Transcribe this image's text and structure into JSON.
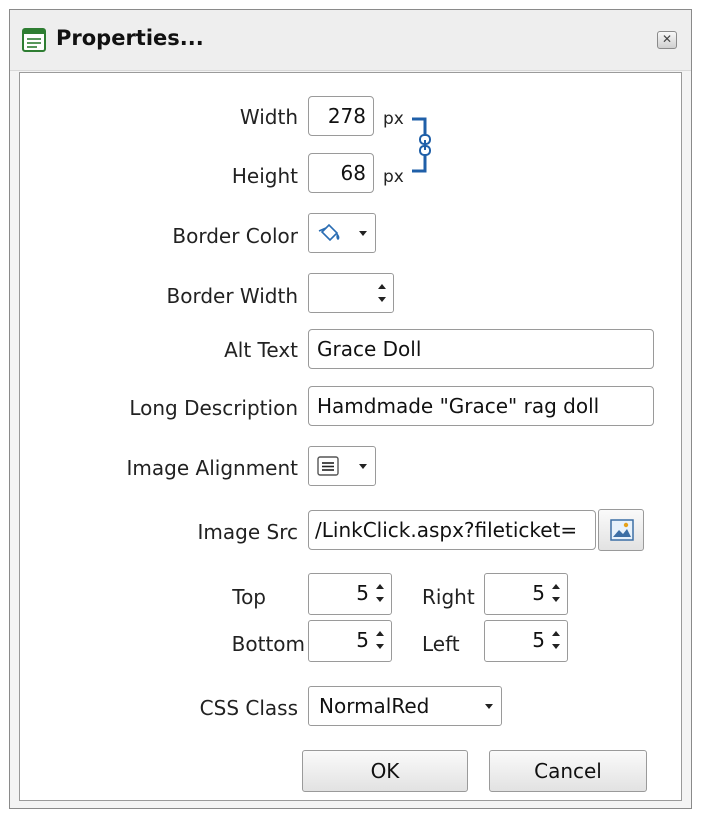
{
  "window": {
    "title": "Properties...",
    "close_glyph": "✕"
  },
  "fields": {
    "width": {
      "label": "Width",
      "value": "278",
      "unit": "px"
    },
    "height": {
      "label": "Height",
      "value": "68",
      "unit": "px"
    },
    "border_color": {
      "label": "Border Color",
      "icon": "paint-bucket-icon"
    },
    "border_width": {
      "label": "Border Width",
      "value": ""
    },
    "alt_text": {
      "label": "Alt Text",
      "value": "Grace Doll"
    },
    "long_description": {
      "label": "Long Description",
      "value": "Hamdmade \"Grace\" rag doll"
    },
    "image_alignment": {
      "label": "Image Alignment",
      "icon": "align-lines-icon"
    },
    "image_src": {
      "label": "Image Src",
      "value": "/LinkClick.aspx?fileticket=",
      "icon": "image-browse-icon"
    },
    "margins": {
      "top": {
        "label": "Top",
        "value": "5"
      },
      "right": {
        "label": "Right",
        "value": "5"
      },
      "bottom": {
        "label": "Bottom",
        "value": "5"
      },
      "left": {
        "label": "Left",
        "value": "5"
      }
    },
    "css_class": {
      "label": "CSS Class",
      "value": "NormalRed"
    }
  },
  "buttons": {
    "ok": "OK",
    "cancel": "Cancel"
  },
  "colors": {
    "link_chain": "#1f5fa8"
  }
}
